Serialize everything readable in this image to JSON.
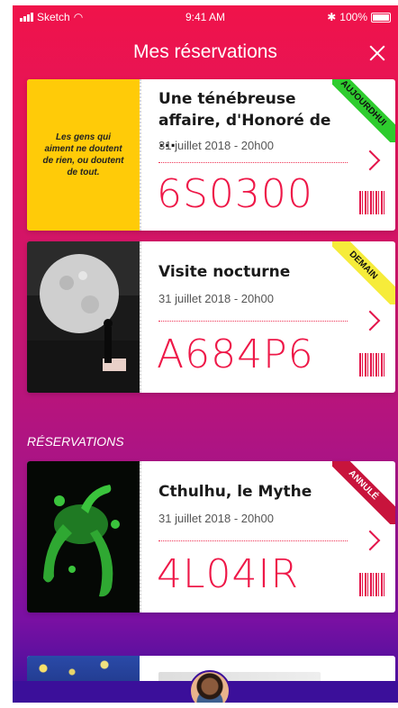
{
  "status_bar": {
    "carrier": "Sketch",
    "time": "9:41 AM",
    "battery": "100%"
  },
  "nav": {
    "title": "Mes réservations"
  },
  "cards": [
    {
      "title": "Une ténébreuse affaire, d'Honoré de ...",
      "date": "31 juillet 2018 - 20h00",
      "code": "6S0300",
      "ribbon": "AUJOURDHUI",
      "ribbon_color": "#2ecc2e",
      "quote": "Les gens qui aiment ne doutent de rien, ou doutent de tout."
    },
    {
      "title": "Visite nocturne",
      "date": "31 juillet 2018 - 20h00",
      "code": "A684P6",
      "ribbon": "DEMAIN",
      "ribbon_color": "#f6ec3a"
    }
  ],
  "section": {
    "title": "RÉSERVATIONS"
  },
  "past_cards": [
    {
      "title": "Cthulhu, le Mythe",
      "date": "31 juillet 2018 - 20h00",
      "code": "4L04IR",
      "ribbon": "ANNULÉ",
      "ribbon_color": "#c8143c"
    }
  ],
  "colors": {
    "accent": "#e3144a",
    "tabbar": "#3b0f9a"
  }
}
